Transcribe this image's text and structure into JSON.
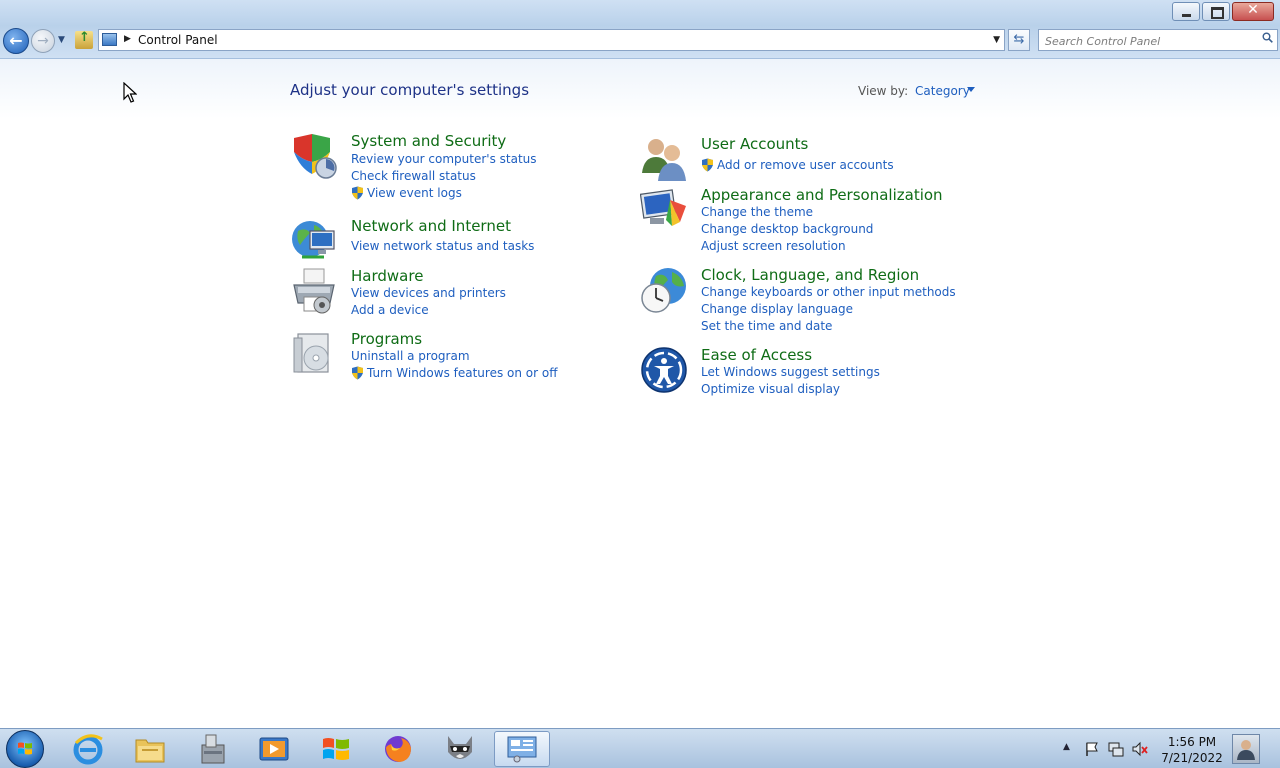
{
  "window": {
    "minimize_glyph": "–",
    "maximize_glyph": "□",
    "close_glyph": "✕"
  },
  "address": {
    "path": "Control Panel",
    "search_placeholder": "Search Control Panel"
  },
  "header": {
    "title": "Adjust your computer's settings",
    "view_by_label": "View by:",
    "view_by_value": "Category"
  },
  "categories_left": [
    {
      "title": "System and Security",
      "icon": "shield-security-icon",
      "links": [
        {
          "label": "Review your computer's status",
          "shield": false
        },
        {
          "label": "Check firewall status",
          "shield": false
        },
        {
          "label": "View event logs",
          "shield": true
        }
      ]
    },
    {
      "title": "Network and Internet",
      "icon": "network-globe-icon",
      "links": [
        {
          "label": "View network status and tasks",
          "shield": false
        }
      ]
    },
    {
      "title": "Hardware",
      "icon": "printer-icon",
      "links": [
        {
          "label": "View devices and printers",
          "shield": false
        },
        {
          "label": "Add a device",
          "shield": false
        }
      ]
    },
    {
      "title": "Programs",
      "icon": "programs-disc-icon",
      "links": [
        {
          "label": "Uninstall a program",
          "shield": false
        },
        {
          "label": "Turn Windows features on or off",
          "shield": true
        }
      ]
    }
  ],
  "categories_right": [
    {
      "title": "User Accounts",
      "icon": "users-icon",
      "links": [
        {
          "label": "Add or remove user accounts",
          "shield": true
        }
      ]
    },
    {
      "title": "Appearance and Personalization",
      "icon": "monitor-palette-icon",
      "links": [
        {
          "label": "Change the theme",
          "shield": false
        },
        {
          "label": "Change desktop background",
          "shield": false
        },
        {
          "label": "Adjust screen resolution",
          "shield": false
        }
      ]
    },
    {
      "title": "Clock, Language, and Region",
      "icon": "clock-globe-icon",
      "links": [
        {
          "label": "Change keyboards or other input methods",
          "shield": false
        },
        {
          "label": "Change display language",
          "shield": false
        },
        {
          "label": "Set the time and date",
          "shield": false
        }
      ]
    },
    {
      "title": "Ease of Access",
      "icon": "ease-of-access-icon",
      "links": [
        {
          "label": "Let Windows suggest settings",
          "shield": false
        },
        {
          "label": "Optimize visual display",
          "shield": false
        }
      ]
    }
  ],
  "taskbar": {
    "apps": [
      "internet-explorer-icon",
      "file-explorer-icon",
      "archive-tool-icon",
      "media-player-icon",
      "windows-flag-icon",
      "firefox-icon",
      "raccoon-app-icon",
      "control-panel-icon"
    ],
    "tray_icons": [
      "action-center-flag-icon",
      "network-icon",
      "volume-muted-icon"
    ],
    "time": "1:56 PM",
    "date": "7/21/2022"
  },
  "colors": {
    "category_title": "#0f6c16",
    "link": "#1e5ebf",
    "heading": "#1e3287"
  }
}
